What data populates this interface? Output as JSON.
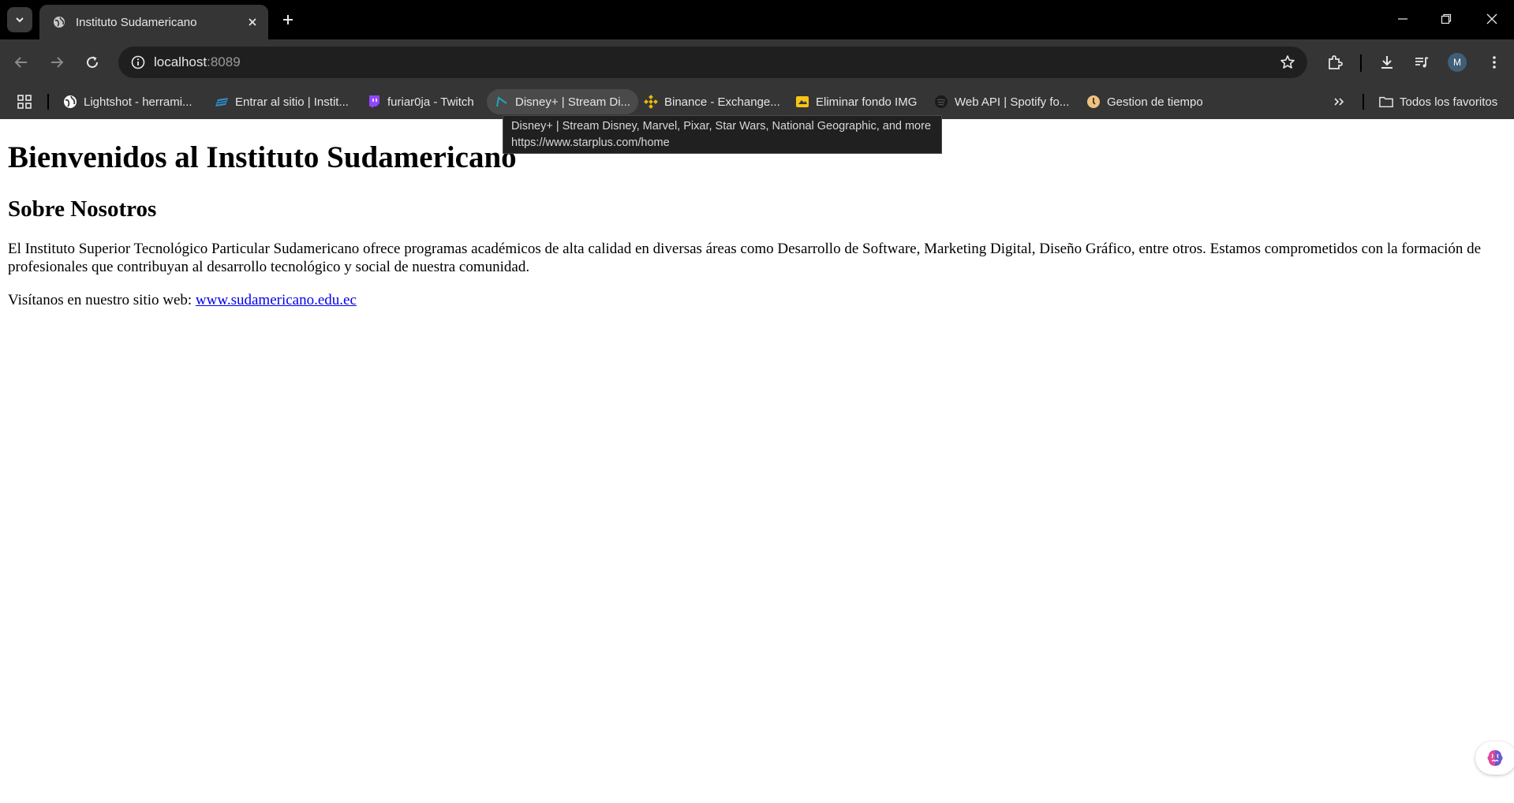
{
  "browser": {
    "tab": {
      "title": "Instituto Sudamericano"
    },
    "address": {
      "host": "localhost",
      "port": ":8089"
    },
    "avatar_initial": "M",
    "bookmarks": [
      {
        "label": "Lightshot - herrami...",
        "icon": "globe-icon"
      },
      {
        "label": "Entrar al sitio | Instit...",
        "icon": "moodle-icon"
      },
      {
        "label": "furiar0ja - Twitch",
        "icon": "twitch-icon"
      },
      {
        "label": "Disney+ | Stream Di...",
        "icon": "disney-icon"
      },
      {
        "label": "Binance - Exchange...",
        "icon": "binance-icon"
      },
      {
        "label": "Eliminar fondo IMG",
        "icon": "image-icon"
      },
      {
        "label": "Web API | Spotify fo...",
        "icon": "spotify-icon"
      },
      {
        "label": "Gestion de tiempo",
        "icon": "clock-icon"
      }
    ],
    "all_bookmarks_label": "Todos los favoritos",
    "tooltip": {
      "line1": "Disney+ | Stream Disney, Marvel, Pixar, Star Wars, National Geographic, and more",
      "line2": "https://www.starplus.com/home"
    },
    "colors": {
      "chrome_dark": "#353535",
      "titlebar": "#000000",
      "link": "#0000ee"
    }
  },
  "page": {
    "heading": "Bienvenidos al Instituto Sudamericano",
    "section_title": "Sobre Nosotros",
    "description": "El Instituto Superior Tecnológico Particular Sudamericano ofrece programas académicos de alta calidad en diversas áreas como Desarrollo de Software, Marketing Digital, Diseño Gráfico, entre otros. Estamos comprometidos con la formación de profesionales que contribuyan al desarrollo tecnológico y social de nuestra comunidad.",
    "visit_text": "Visítanos en nuestro sitio web: ",
    "visit_link": "www.sudamericano.edu.ec"
  }
}
